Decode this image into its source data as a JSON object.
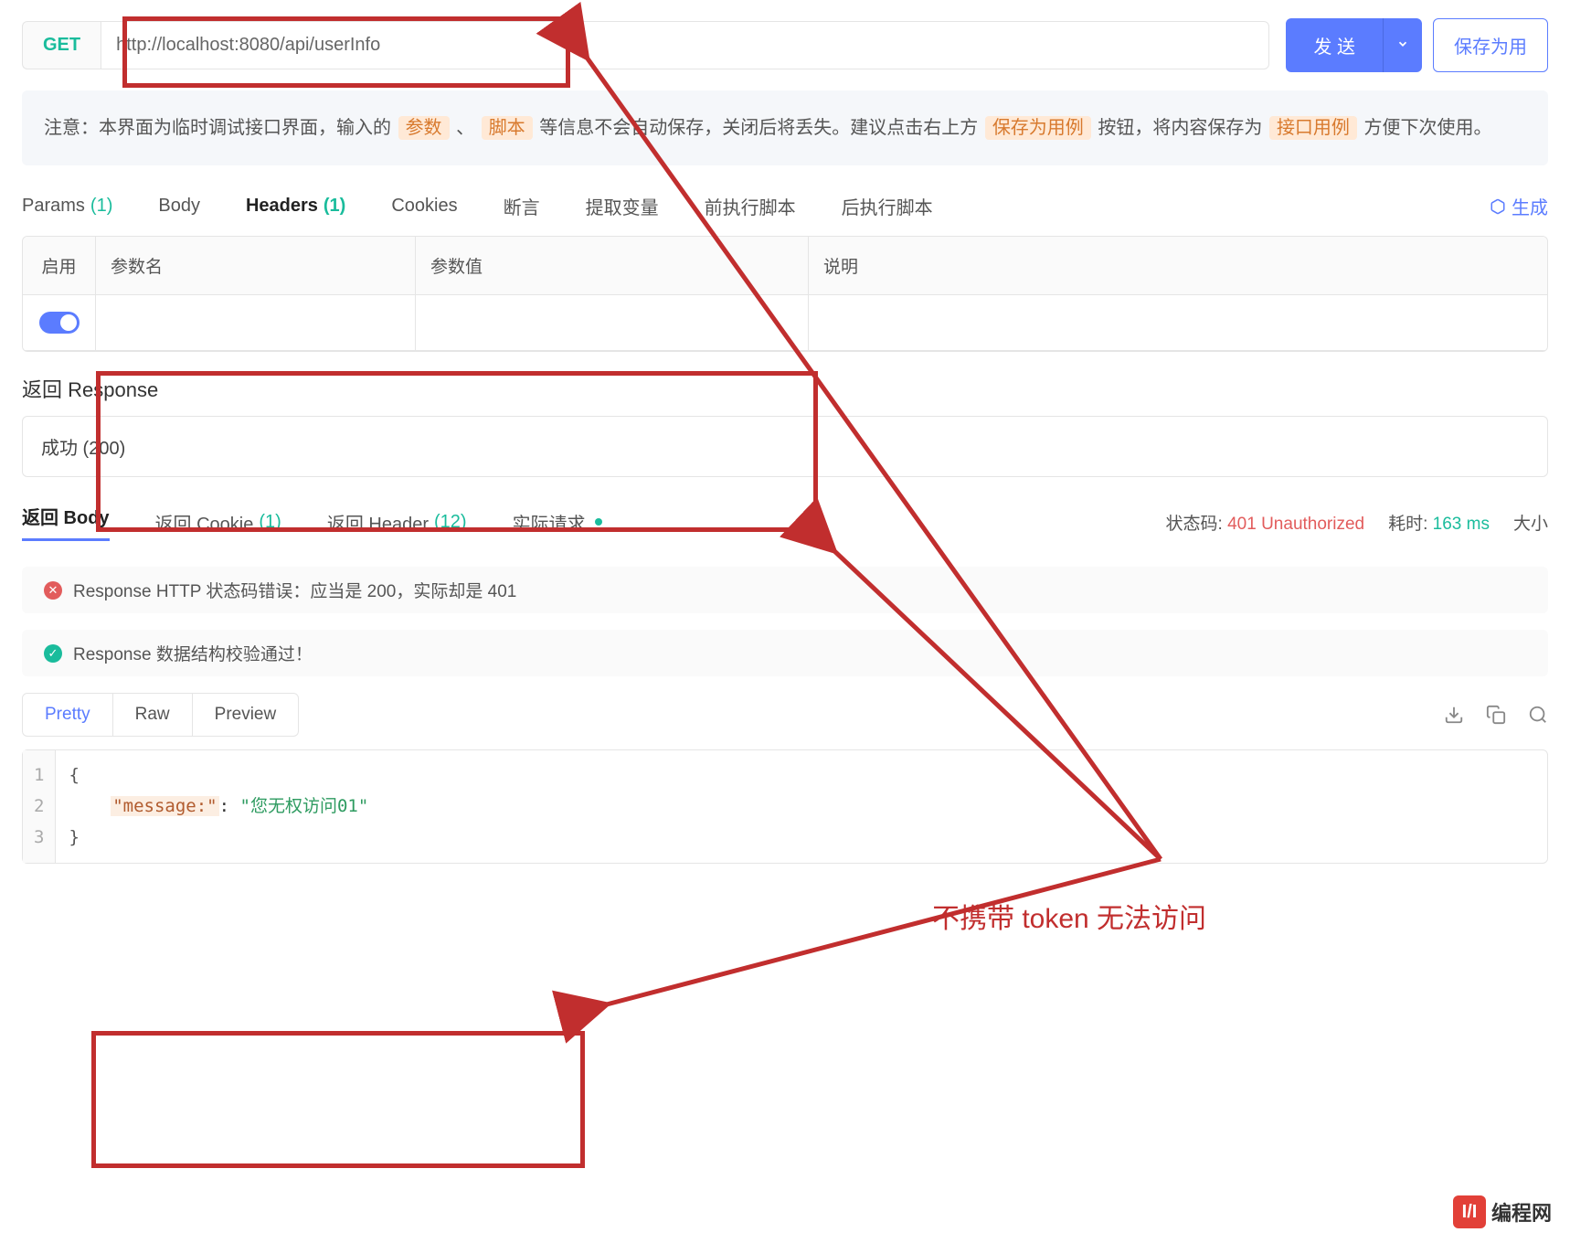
{
  "request": {
    "method": "GET",
    "url": "http://localhost:8080/api/userInfo",
    "send_label": "发 送",
    "save_label": "保存为用"
  },
  "notice": {
    "prefix": "注意：本界面为临时调试接口界面，输入的 ",
    "hl_params": "参数",
    "sep1": " 、 ",
    "hl_script": "脚本",
    "mid": " 等信息不会自动保存，关闭后将丢失。建议点击右上方 ",
    "hl_save": "保存为用例",
    "after_save": " 按钮，将内容保存为 ",
    "hl_case": "接口用例",
    "suffix": " 方便下次使用。"
  },
  "tabs": {
    "params": "Params",
    "params_count": "(1)",
    "body": "Body",
    "headers": "Headers",
    "headers_count": "(1)",
    "cookies": "Cookies",
    "assert": "断言",
    "extract": "提取变量",
    "pre": "前执行脚本",
    "post": "后执行脚本",
    "generate": "生成"
  },
  "headers_table": {
    "col_enable": "启用",
    "col_name": "参数名",
    "col_value": "参数值",
    "col_desc": "说明"
  },
  "response": {
    "title": "返回 Response",
    "status_select": "成功 (200)",
    "tabs": {
      "body": "返回 Body",
      "cookie": "返回 Cookie",
      "cookie_count": "(1)",
      "header": "返回 Header",
      "header_count": "(12)",
      "actual": "实际请求"
    },
    "meta": {
      "status_label": "状态码:",
      "status_value": "401 Unauthorized",
      "time_label": "耗时:",
      "time_value": "163 ms",
      "size_label": "大小"
    },
    "msg_error": "Response HTTP 状态码错误：应当是 200，实际却是 401",
    "msg_ok": "Response 数据结构校验通过！",
    "body_tabs": {
      "pretty": "Pretty",
      "raw": "Raw",
      "preview": "Preview"
    },
    "json_body": {
      "key": "\"message:\"",
      "value": "\"您无权访问01\""
    }
  },
  "annotation": {
    "text": "不携带 token 无法访问"
  },
  "watermark": {
    "text": "编程网"
  }
}
